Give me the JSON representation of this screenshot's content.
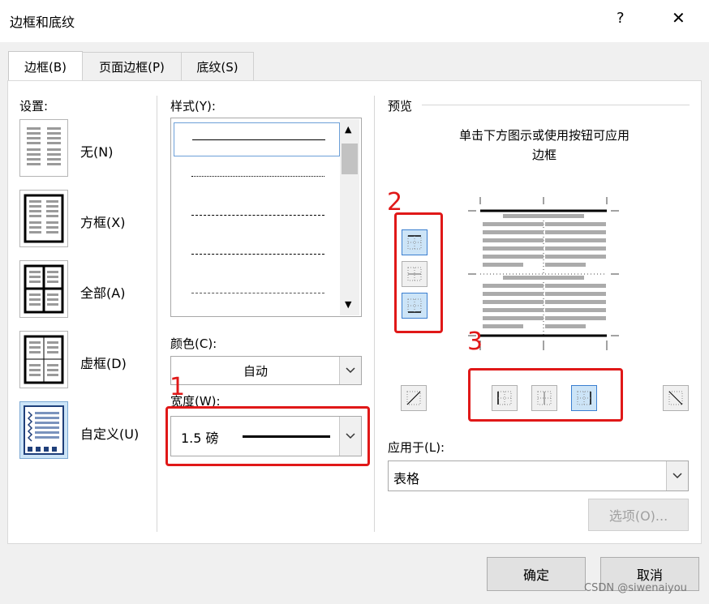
{
  "window": {
    "title": "边框和底纹",
    "help": "?",
    "close": "✕"
  },
  "tabs": [
    {
      "label": "边框(B)",
      "active": true
    },
    {
      "label": "页面边框(P)",
      "active": false
    },
    {
      "label": "底纹(S)",
      "active": false
    }
  ],
  "settings": {
    "label": "设置:",
    "items": [
      {
        "label": "无(N)",
        "icon": "none-border-icon"
      },
      {
        "label": "方框(X)",
        "icon": "box-border-icon"
      },
      {
        "label": "全部(A)",
        "icon": "all-border-icon"
      },
      {
        "label": "虚框(D)",
        "icon": "grid-border-icon"
      },
      {
        "label": "自定义(U)",
        "icon": "custom-border-icon",
        "selected": true
      }
    ]
  },
  "style": {
    "label": "样式(Y):",
    "items": [
      "solid",
      "dotted",
      "dashed-fine",
      "dashed",
      "dash-dot"
    ]
  },
  "color": {
    "label": "颜色(C):",
    "value": "自动"
  },
  "width": {
    "label": "宽度(W):",
    "value": "1.5 磅"
  },
  "preview": {
    "label": "预览",
    "hint_line1": "单击下方图示或使用按钮可应用",
    "hint_line2": "边框"
  },
  "apply_to": {
    "label": "应用于(L):",
    "value": "表格"
  },
  "options_button": "选项(O)...",
  "ok_button": "确定",
  "cancel_button": "取消",
  "annotations": {
    "n1": "1",
    "n2": "2",
    "n3": "3",
    "color": "#e01818"
  },
  "watermark": "CSDN @siwenaiyou"
}
